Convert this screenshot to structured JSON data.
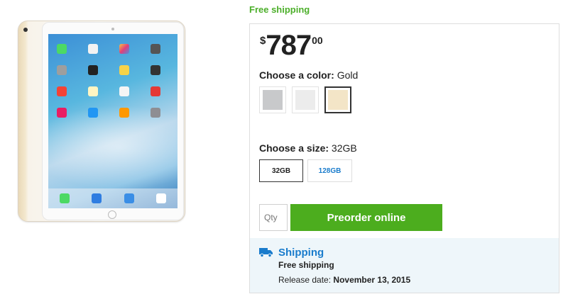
{
  "shipping_banner": "Free shipping",
  "price": {
    "currency": "$",
    "dollars": "787",
    "cents": "00"
  },
  "color": {
    "label": "Choose a color:",
    "selected": "Gold",
    "options": [
      {
        "name": "Space Gray",
        "hex": "#c8c9cb"
      },
      {
        "name": "Silver",
        "hex": "#ececec"
      },
      {
        "name": "Gold",
        "hex": "#f3e5c7"
      }
    ]
  },
  "size": {
    "label": "Choose a size:",
    "selected": "32GB",
    "options": [
      "32GB",
      "128GB"
    ]
  },
  "purchase": {
    "qty_placeholder": "Qty",
    "preorder_label": "Preorder online"
  },
  "shipping": {
    "title": "Shipping",
    "method": "Free shipping",
    "release_label": "Release date:",
    "release_date": "November 13, 2015"
  },
  "colors": {
    "accent_green": "#4cad1e",
    "link_blue": "#1a7ccc",
    "banner_green": "#4caf2a",
    "shipping_bg": "#eef6fa"
  },
  "icons": {
    "shipping": "truck-icon"
  }
}
